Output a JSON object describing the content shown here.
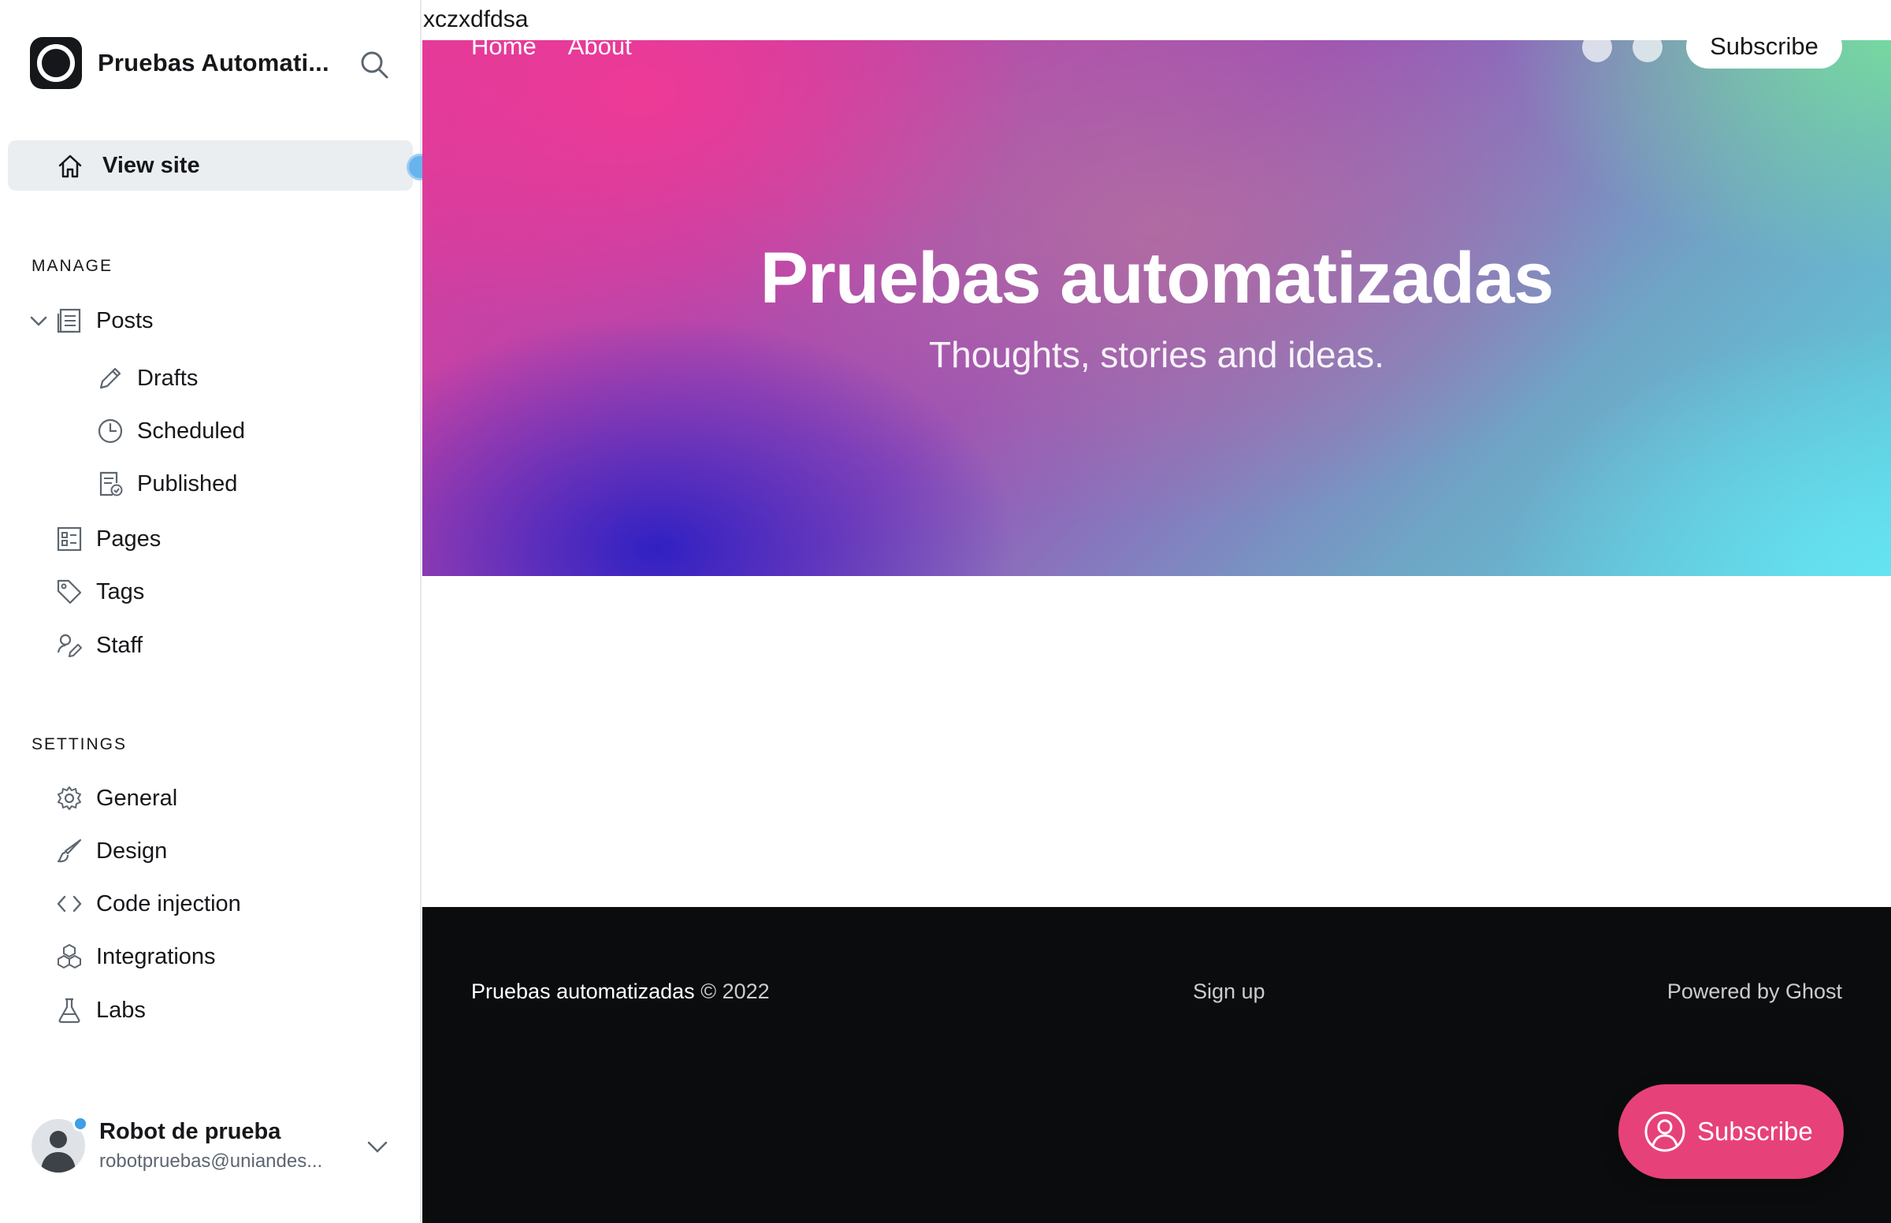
{
  "sidebar": {
    "site_title": "Pruebas Automati...",
    "view_site_label": "View site",
    "manage_heading": "MANAGE",
    "posts_label": "Posts",
    "drafts_label": "Drafts",
    "scheduled_label": "Scheduled",
    "published_label": "Published",
    "pages_label": "Pages",
    "tags_label": "Tags",
    "staff_label": "Staff",
    "settings_heading": "SETTINGS",
    "general_label": "General",
    "design_label": "Design",
    "code_injection_label": "Code injection",
    "integrations_label": "Integrations",
    "labs_label": "Labs",
    "user": {
      "name": "Robot de prueba",
      "email": "robotpruebas@uniandes..."
    }
  },
  "preview": {
    "top_text": "xczxdfdsa",
    "nav": [
      "Home",
      "About"
    ],
    "subscribe_label": "Subscribe",
    "hero_title": "Pruebas automatizadas",
    "hero_subtitle": "Thoughts, stories and ideas.",
    "footer": {
      "site_name": "Pruebas automatizadas",
      "copyright": "© 2022",
      "signup": "Sign up",
      "powered": "Powered by Ghost"
    },
    "portal_button_label": "Subscribe"
  },
  "colors": {
    "accent": "#e7417a",
    "notification_dot": "#3f9ee8",
    "footer_bg": "#0b0c0d",
    "active_item_bg": "#ebeef0"
  },
  "icons": [
    "search-icon",
    "home-icon",
    "posts-icon",
    "pencil-icon",
    "clock-icon",
    "published-icon",
    "pages-icon",
    "tag-icon",
    "staff-icon",
    "gear-icon",
    "brush-icon",
    "code-icon",
    "integrations-icon",
    "flask-icon",
    "chevron-down-icon",
    "user-circle-icon"
  ]
}
